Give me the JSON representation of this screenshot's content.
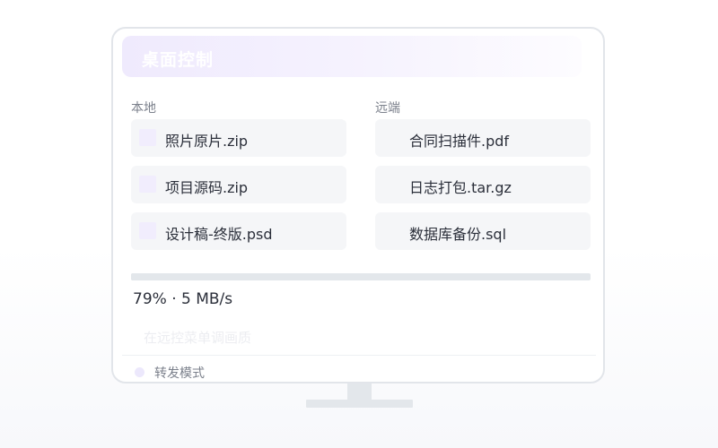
{
  "header": {
    "title": "桌面控制"
  },
  "local": {
    "label": "本地",
    "files": [
      {
        "name": "照片原片.zip"
      },
      {
        "name": "项目源码.zip"
      },
      {
        "name": "设计稿-终版.psd"
      }
    ]
  },
  "remote": {
    "label": "远端",
    "files": [
      {
        "name": "合同扫描件.pdf"
      },
      {
        "name": "日志打包.tar.gz"
      },
      {
        "name": "数据库备份.sql"
      }
    ]
  },
  "transfer": {
    "progress_percent": 79,
    "status_text": "79% · 5 MB/s"
  },
  "hint": {
    "text": "在远控菜单调画质"
  },
  "mode": {
    "label": "转发模式"
  },
  "colors": {
    "accent_light": "#efeafd",
    "file_bg": "#f5f6f8",
    "checkbox": "#f1edfd",
    "track": "#e3e7eb",
    "border": "#e2e5ea"
  }
}
